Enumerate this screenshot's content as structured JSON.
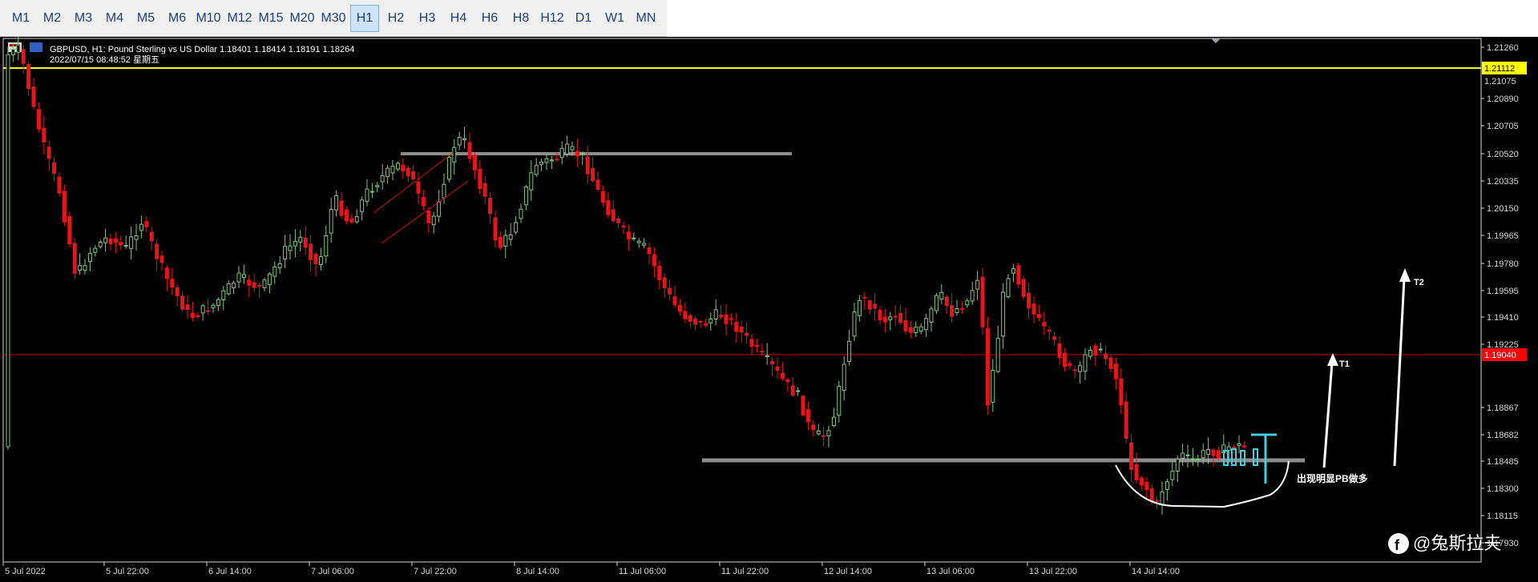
{
  "toolbar": {
    "timeframes": [
      {
        "label": "M1",
        "active": false
      },
      {
        "label": "M2",
        "active": false
      },
      {
        "label": "M3",
        "active": false
      },
      {
        "label": "M4",
        "active": false
      },
      {
        "label": "M5",
        "active": false
      },
      {
        "label": "M6",
        "active": false
      },
      {
        "label": "M10",
        "active": false
      },
      {
        "label": "M12",
        "active": false
      },
      {
        "label": "M15",
        "active": false
      },
      {
        "label": "M20",
        "active": false
      },
      {
        "label": "M30",
        "active": false
      },
      {
        "label": "H1",
        "active": true
      },
      {
        "label": "H2",
        "active": false
      },
      {
        "label": "H3",
        "active": false
      },
      {
        "label": "H4",
        "active": false
      },
      {
        "label": "H6",
        "active": false
      },
      {
        "label": "H8",
        "active": false
      },
      {
        "label": "H12",
        "active": false
      },
      {
        "label": "D1",
        "active": false
      },
      {
        "label": "W1",
        "active": false
      },
      {
        "label": "MN",
        "active": false
      }
    ]
  },
  "chart": {
    "symbol_line": "GBPUSD, H1:  Pound Sterling vs US Dollar  1.18401 1.18414 1.18191 1.18264",
    "datetime_line": "2022/07/15 08:48:52 星期五",
    "price_labels": [
      "1.21260",
      "1.20890",
      "1.20705",
      "1.20520",
      "1.20335",
      "1.20150",
      "1.19965",
      "1.19780",
      "1.19595",
      "1.19410",
      "1.19225",
      "1.18867",
      "1.18682",
      "1.18485",
      "1.18300",
      "1.18115",
      "1.17930"
    ],
    "highlight_prices": {
      "yellow": {
        "label": "1.21112",
        "color": "#ffff00",
        "text_color": "#000000"
      },
      "red": {
        "label": "1.19040",
        "color": "#ff0000",
        "text_color": "#ffffff"
      },
      "partial": "1.21075"
    },
    "time_labels": [
      "5 Jul 2022",
      "5 Jul 22:00",
      "6 Jul 14:00",
      "7 Jul 06:00",
      "7 Jul 22:00",
      "8 Jul 14:00",
      "11 Jul 06:00",
      "11 Jul 22:00",
      "12 Jul 14:00",
      "13 Jul 06:00",
      "13 Jul 22:00",
      "14 Jul 14:00"
    ],
    "annotations": {
      "t1": "T1",
      "t2": "T2",
      "note": "出现明显PB做多"
    },
    "watermark": "@兔斯拉夫",
    "colors": {
      "bull": "#7fc97f",
      "bear": "#e8141c",
      "gray_line": "#8c8c8c",
      "cyan": "#40d0e0"
    }
  }
}
